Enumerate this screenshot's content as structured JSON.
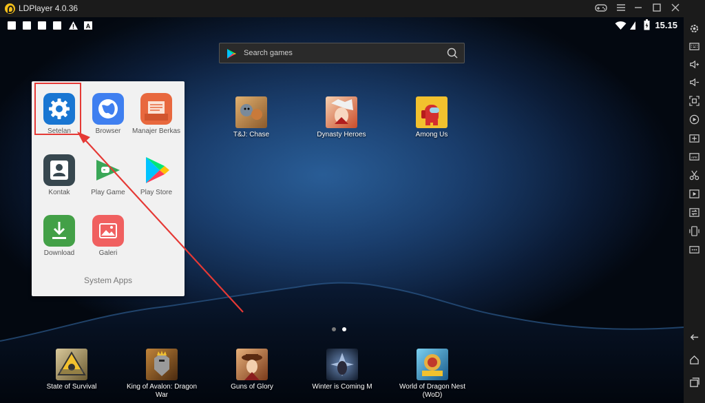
{
  "window": {
    "title": "LDPlayer 4.0.36"
  },
  "status": {
    "time": "15.15",
    "battery_glyph": "▮"
  },
  "search": {
    "placeholder": "Search games"
  },
  "folder": {
    "title": "System Apps",
    "apps": [
      {
        "label": "Setelan",
        "icon": "gear-icon",
        "color": "#1976d2"
      },
      {
        "label": "Browser",
        "icon": "globe-icon",
        "color": "#3f7ff0"
      },
      {
        "label": "Manajer Berkas",
        "icon": "folder-icon",
        "color": "#e8683e"
      },
      {
        "label": "Kontak",
        "icon": "contact-icon",
        "color": "#37474f"
      },
      {
        "label": "Play Game",
        "icon": "play-games-icon",
        "color": "#3aa757"
      },
      {
        "label": "Play Store",
        "icon": "play-store-icon",
        "color": "#ffffff"
      },
      {
        "label": "Download",
        "icon": "download-icon",
        "color": "#43a047"
      },
      {
        "label": "Galeri",
        "icon": "gallery-icon",
        "color": "#f06060"
      }
    ]
  },
  "desktop": {
    "top_apps": [
      {
        "label": "T&J: Chase",
        "color": "#9c6b3c"
      },
      {
        "label": "Dynasty Heroes",
        "color": "#c94c2a"
      },
      {
        "label": "Among Us",
        "color": "#c62828"
      }
    ],
    "bottom_apps": [
      {
        "label": "State of Survival",
        "color": "#8a7a4a"
      },
      {
        "label": "King of Avalon: Dragon War",
        "color": "#8a5a2a"
      },
      {
        "label": "Guns of Glory",
        "color": "#b06a3a"
      },
      {
        "label": "Winter is Coming M",
        "color": "#3a4a6a"
      },
      {
        "label": "World of Dragon Nest (WoD)",
        "color": "#2d7fb8"
      }
    ]
  },
  "colors": {
    "highlight": "#e53935",
    "accent": "#f5c01a"
  }
}
